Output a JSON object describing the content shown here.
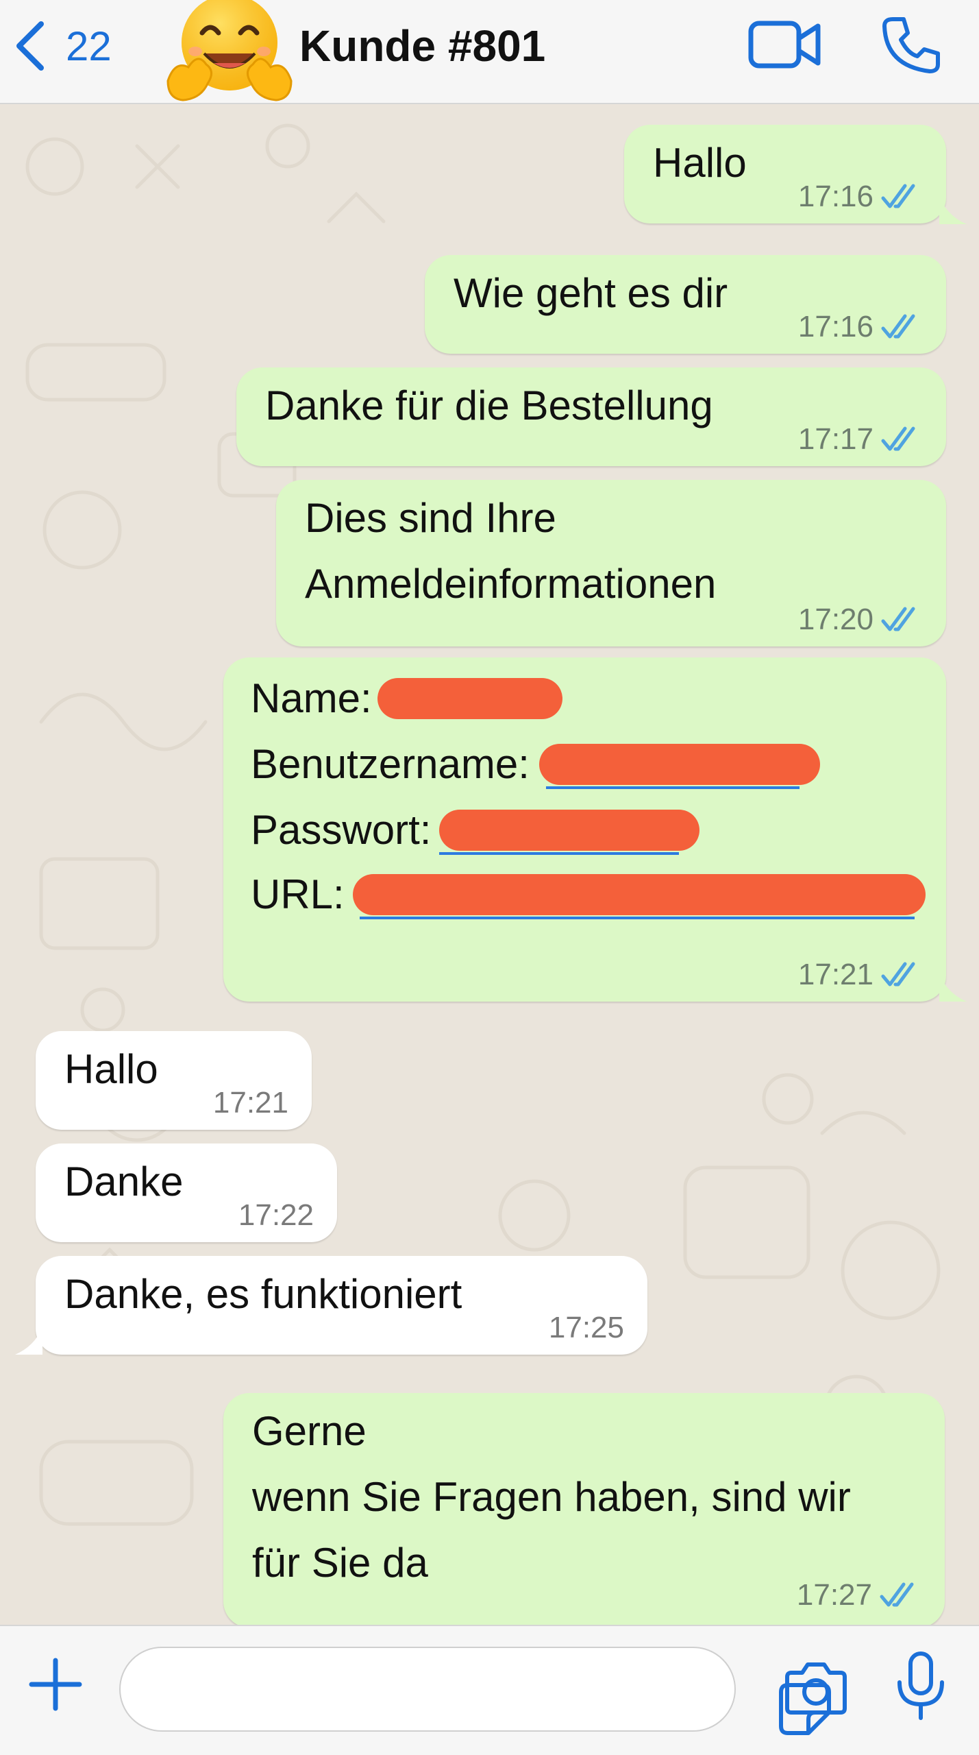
{
  "header": {
    "back_count": "22",
    "title": "Kunde #801",
    "avatar_emoji": "hugging-face-emoji",
    "icons": [
      "chevron-left-icon",
      "video-call-icon",
      "phone-call-icon"
    ],
    "accent_color": "#1B6FD8"
  },
  "messages": [
    {
      "dir": "out",
      "text": "Hallo",
      "time": "17:16",
      "status": "read"
    },
    {
      "dir": "out",
      "text": "Wie geht es dir",
      "time": "17:16",
      "status": "read"
    },
    {
      "dir": "out",
      "text": "Danke für die Bestellung",
      "time": "17:17",
      "status": "read"
    },
    {
      "dir": "out",
      "text": "Dies sind Ihre\nAnmeldeinformationen",
      "time": "17:20",
      "status": "read"
    },
    {
      "dir": "out",
      "credentials": {
        "name_label": "Name:",
        "username_label": "Benutzername:",
        "password_label": "Passwort:",
        "url_label": "URL:"
      },
      "time": "17:21",
      "status": "read"
    },
    {
      "dir": "in",
      "text": "Hallo",
      "time": "17:21"
    },
    {
      "dir": "in",
      "text": "Danke",
      "time": "17:22"
    },
    {
      "dir": "in",
      "text": "Danke, es funktioniert",
      "time": "17:25"
    },
    {
      "dir": "out",
      "text": "Gerne\nwenn Sie Fragen haben, sind wir\nfür Sie da",
      "time": "17:27",
      "status": "read"
    }
  ],
  "colors": {
    "outgoing_bubble": "#DCF8C6",
    "incoming_bubble": "#FFFFFF",
    "redaction": "#F4603A",
    "read_ticks": "#4FA3E0"
  },
  "input_bar": {
    "icons": [
      "plus-icon",
      "sticker-icon",
      "camera-icon",
      "microphone-icon"
    ]
  }
}
